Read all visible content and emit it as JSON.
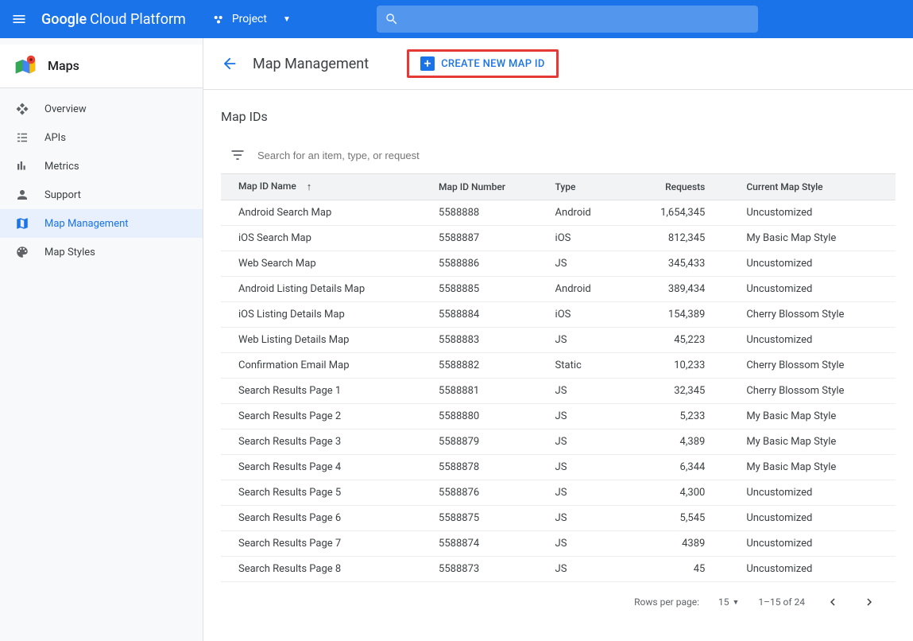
{
  "topbar": {
    "brand_bold": "Google",
    "brand_rest": "Cloud Platform",
    "project_label": "Project"
  },
  "sidebar": {
    "title": "Maps",
    "items": [
      {
        "label": "Overview",
        "icon": "diamond"
      },
      {
        "label": "APIs",
        "icon": "list"
      },
      {
        "label": "Metrics",
        "icon": "bars"
      },
      {
        "label": "Support",
        "icon": "person"
      },
      {
        "label": "Map Management",
        "icon": "map",
        "active": true
      },
      {
        "label": "Map Styles",
        "icon": "palette"
      }
    ]
  },
  "page": {
    "title": "Map Management",
    "create_button": "CREATE NEW MAP ID",
    "section_title": "Map IDs",
    "filter_placeholder": "Search for an item, type, or request"
  },
  "table": {
    "headers": {
      "name": "Map ID Name",
      "number": "Map ID Number",
      "type": "Type",
      "requests": "Requests",
      "style": "Current Map Style"
    },
    "rows": [
      {
        "name": "Android Search Map",
        "number": "5588888",
        "type": "Android",
        "requests": "1,654,345",
        "style": "Uncustomized"
      },
      {
        "name": "iOS Search Map",
        "number": "5588887",
        "type": "iOS",
        "requests": "812,345",
        "style": "My Basic Map Style"
      },
      {
        "name": "Web Search Map",
        "number": "5588886",
        "type": "JS",
        "requests": "345,433",
        "style": "Uncustomized"
      },
      {
        "name": "Android Listing Details Map",
        "number": "5588885",
        "type": "Android",
        "requests": "389,434",
        "style": "Uncustomized"
      },
      {
        "name": "iOS Listing Details Map",
        "number": "5588884",
        "type": "iOS",
        "requests": "154,389",
        "style": "Cherry Blossom Style"
      },
      {
        "name": "Web Listing Details Map",
        "number": "5588883",
        "type": "JS",
        "requests": "45,223",
        "style": "Uncustomized"
      },
      {
        "name": "Confirmation Email Map",
        "number": "5588882",
        "type": "Static",
        "requests": "10,233",
        "style": "Cherry Blossom Style"
      },
      {
        "name": "Search Results Page 1",
        "number": "5588881",
        "type": "JS",
        "requests": "32,345",
        "style": "Cherry Blossom Style"
      },
      {
        "name": "Search Results Page 2",
        "number": "5588880",
        "type": "JS",
        "requests": "5,233",
        "style": "My Basic Map Style"
      },
      {
        "name": "Search Results Page 3",
        "number": "5588879",
        "type": "JS",
        "requests": "4,389",
        "style": "My Basic Map Style"
      },
      {
        "name": "Search Results Page 4",
        "number": "5588878",
        "type": "JS",
        "requests": "6,344",
        "style": "My Basic Map Style"
      },
      {
        "name": "Search Results Page 5",
        "number": "5588876",
        "type": "JS",
        "requests": "4,300",
        "style": "Uncustomized"
      },
      {
        "name": "Search Results Page 6",
        "number": "5588875",
        "type": "JS",
        "requests": "5,545",
        "style": "Uncustomized"
      },
      {
        "name": "Search Results Page 7",
        "number": "5588874",
        "type": "JS",
        "requests": "4389",
        "style": "Uncustomized"
      },
      {
        "name": "Search Results Page 8",
        "number": "5588873",
        "type": "JS",
        "requests": "45",
        "style": "Uncustomized"
      }
    ]
  },
  "pager": {
    "rows_label": "Rows per page:",
    "rows_value": "15",
    "range": "1–15 of 24"
  }
}
